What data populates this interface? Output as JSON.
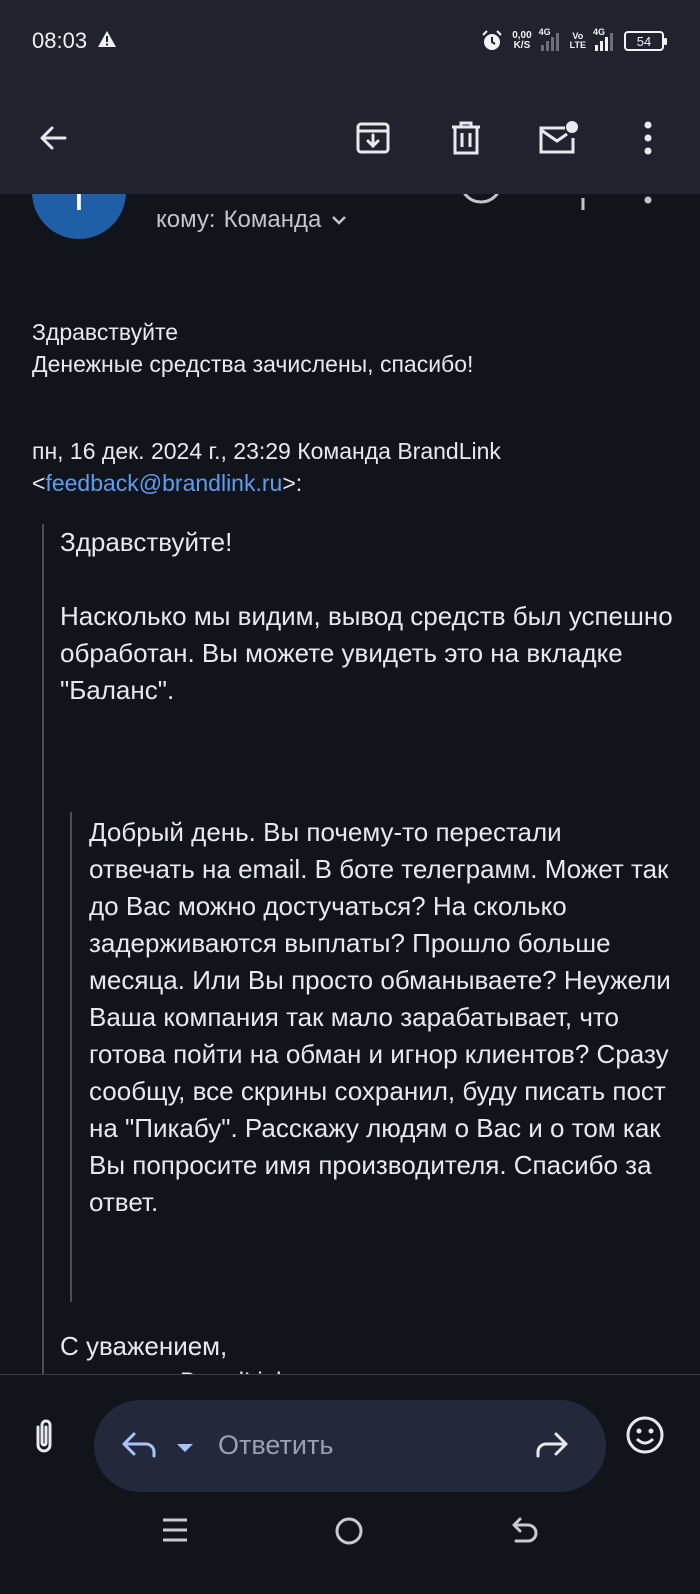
{
  "status_bar": {
    "time": "08:03",
    "net_speed_value": "0,00",
    "net_speed_unit": "K/S",
    "sim1_label": "4G",
    "volte_top": "Vo",
    "volte_bottom": "LTE",
    "sim2_label": "4G",
    "battery": "54"
  },
  "app_bar": {
    "icons": [
      "back-arrow-icon",
      "archive-icon",
      "delete-icon",
      "mark-unread-icon",
      "more-vert-icon"
    ]
  },
  "sender": {
    "avatar_letter": "Т",
    "recipients_prefix": "кому:",
    "recipients": "Команда"
  },
  "message": {
    "reply_lines": [
      "Здравствуйте",
      "Денежные средства зачислены, спасибо!"
    ],
    "quote_header_line1": "пн, 16 дек. 2024 г., 23:29 Команда BrandLink",
    "quote_email": "feedback@brandlink.ru",
    "quote_greeting": "Здравствуйте!",
    "quote_paragraph": "Насколько мы видим, вывод средств был успешно обработан. Вы можете увидеть это на вкладке \"Баланс\".",
    "nested_quote": "Добрый день. Вы почему-то перестали отвечать на email. В боте телеграмм. Может так до Вас можно достучаться? На сколько задерживаются выплаты? Прошло больше месяца. Или Вы просто обманываете? Неужели Ваша компания так мало зарабатывает, что готова пойти на обман и игнор клиентов? Сразу сообщу, все скрины сохранил, буду писать пост на \"Пикабу\". Расскажу людям о Вас и о том как Вы попросите имя производителя. Спасибо за ответ.",
    "signoff": "С уважением,",
    "signature_peek": "BrandLink"
  },
  "reply_bar": {
    "placeholder": "Ответить"
  },
  "colors": {
    "background": "#12141c",
    "bar": "#20232e",
    "link": "#5f9df0",
    "avatar": "#1f5fa8"
  }
}
